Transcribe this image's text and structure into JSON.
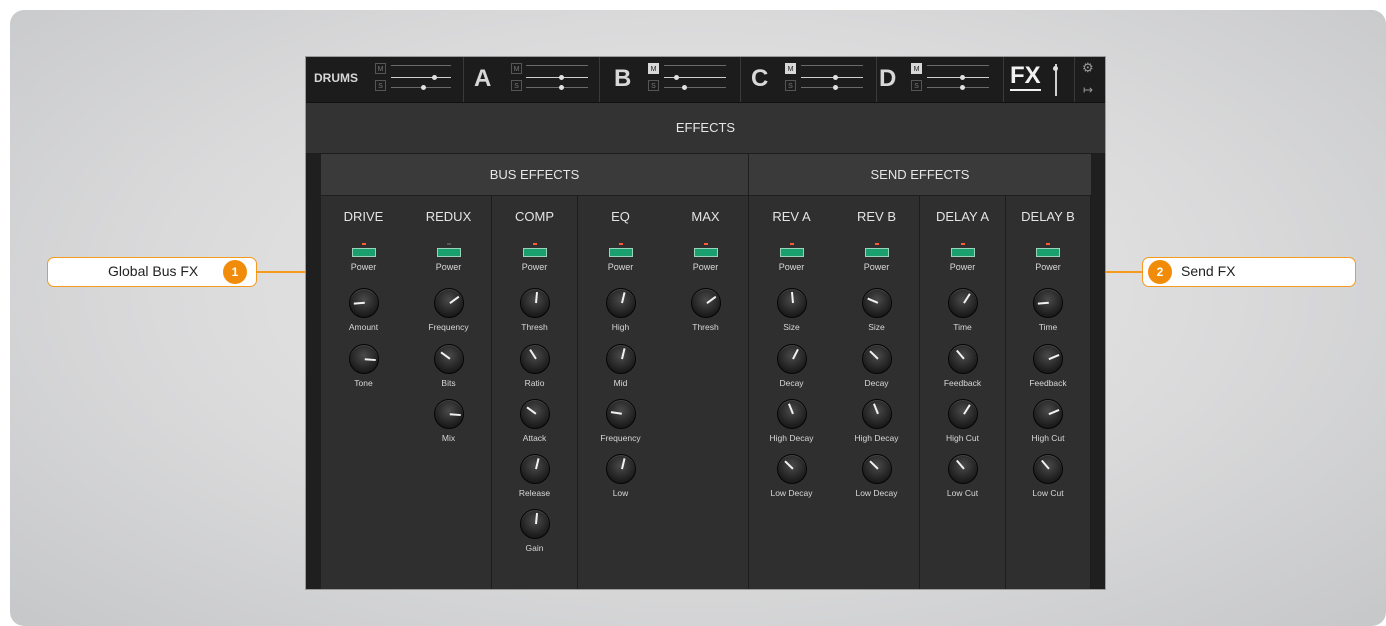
{
  "colors": {
    "accent": "#f39a1f",
    "power_on": "#19a06e",
    "led": "#ff5b3a"
  },
  "topbar": {
    "channels": [
      {
        "name": "DRUMS",
        "mute": "M",
        "solo": "S",
        "mute_active": false
      },
      {
        "name": "A",
        "mute": "M",
        "solo": "S",
        "mute_active": false
      },
      {
        "name": "B",
        "mute": "M",
        "solo": "S",
        "mute_active": true
      },
      {
        "name": "C",
        "mute": "M",
        "solo": "S",
        "mute_active": true
      },
      {
        "name": "D",
        "mute": "M",
        "solo": "S",
        "mute_active": true
      }
    ],
    "fx_label": "FX",
    "icons": [
      "gear-icon",
      "output-routing-icon"
    ]
  },
  "effects_title": "EFFECTS",
  "sections": {
    "bus": "BUS EFFECTS",
    "send": "SEND EFFECTS"
  },
  "power_label": "Power",
  "modules": [
    {
      "title": "DRIVE",
      "power": true,
      "knobs": [
        {
          "label": "Amount",
          "value": 0.15
        },
        {
          "label": "Tone",
          "value": 0.85
        }
      ]
    },
    {
      "title": "REDUX",
      "power": false,
      "knobs": [
        {
          "label": "Frequency",
          "value": 0.7
        },
        {
          "label": "Bits",
          "value": 0.3
        },
        {
          "label": "Mix",
          "value": 0.85
        }
      ]
    },
    {
      "title": "COMP",
      "power": true,
      "knobs": [
        {
          "label": "Thresh",
          "value": 0.52
        },
        {
          "label": "Ratio",
          "value": 0.38
        },
        {
          "label": "Attack",
          "value": 0.3
        },
        {
          "label": "Release",
          "value": 0.55
        },
        {
          "label": "Gain",
          "value": 0.52
        }
      ]
    },
    {
      "title": "EQ",
      "power": true,
      "knobs": [
        {
          "label": "High",
          "value": 0.55
        },
        {
          "label": "Mid",
          "value": 0.55
        },
        {
          "label": "Frequency",
          "value": 0.2
        },
        {
          "label": "Low",
          "value": 0.55
        }
      ]
    },
    {
      "title": "MAX",
      "power": true,
      "knobs": [
        {
          "label": "Thresh",
          "value": 0.7
        }
      ]
    },
    {
      "title": "REV A",
      "power": true,
      "knobs": [
        {
          "label": "Size",
          "value": 0.48
        },
        {
          "label": "Decay",
          "value": 0.6
        },
        {
          "label": "High Decay",
          "value": 0.42
        },
        {
          "label": "Low Decay",
          "value": 0.33
        }
      ]
    },
    {
      "title": "REV B",
      "power": true,
      "knobs": [
        {
          "label": "Size",
          "value": 0.25
        },
        {
          "label": "Decay",
          "value": 0.33
        },
        {
          "label": "High Decay",
          "value": 0.42
        },
        {
          "label": "Low Decay",
          "value": 0.33
        }
      ]
    },
    {
      "title": "DELAY A",
      "power": true,
      "knobs": [
        {
          "label": "Time",
          "value": 0.62
        },
        {
          "label": "Feedback",
          "value": 0.35
        },
        {
          "label": "High Cut",
          "value": 0.62
        },
        {
          "label": "Low Cut",
          "value": 0.35
        }
      ]
    },
    {
      "title": "DELAY B",
      "power": true,
      "knobs": [
        {
          "label": "Time",
          "value": 0.15
        },
        {
          "label": "Feedback",
          "value": 0.75
        },
        {
          "label": "High Cut",
          "value": 0.75
        },
        {
          "label": "Low Cut",
          "value": 0.35
        }
      ]
    }
  ],
  "callouts": [
    {
      "number": "1",
      "text": "Global Bus FX"
    },
    {
      "number": "2",
      "text": "Send FX"
    }
  ]
}
